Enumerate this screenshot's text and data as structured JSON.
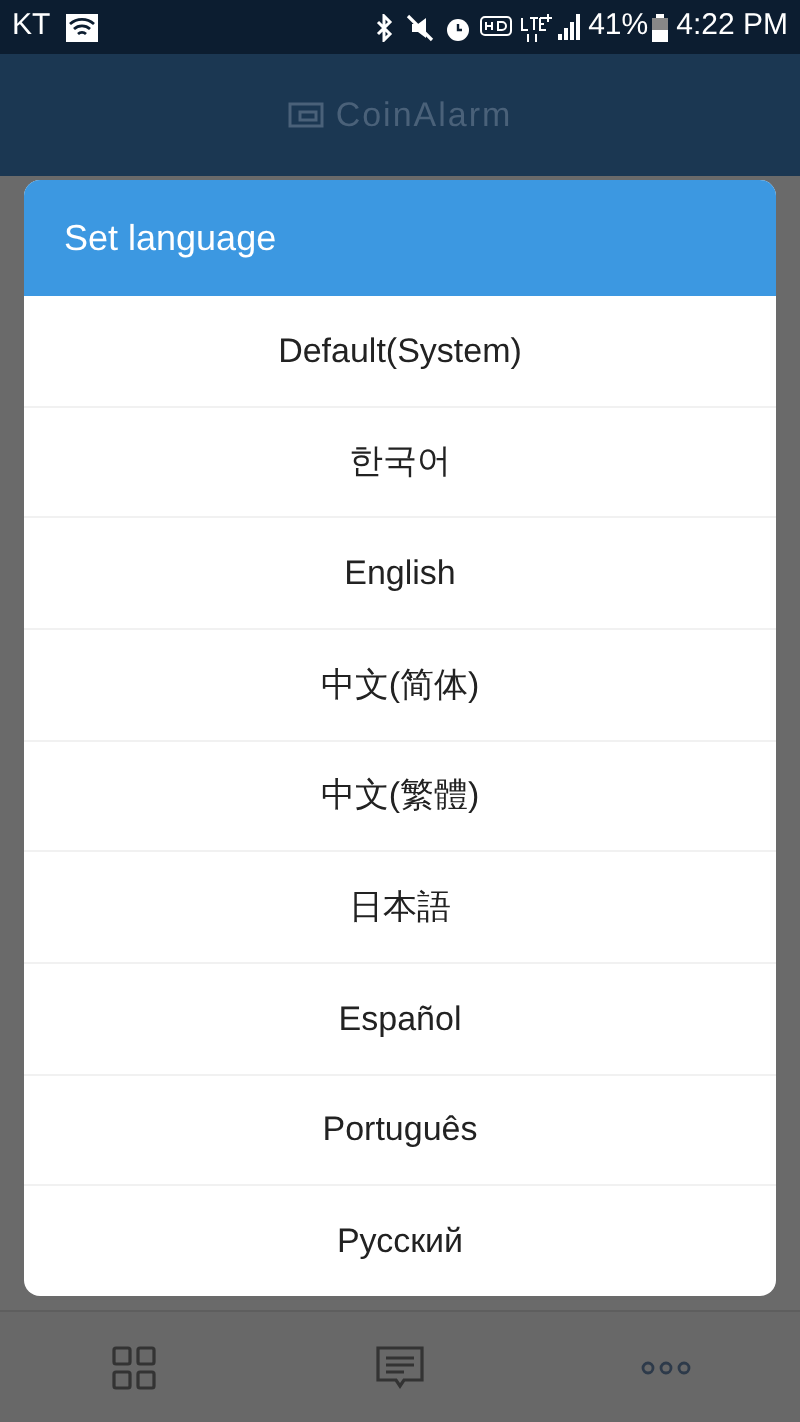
{
  "status_bar": {
    "carrier": "KT",
    "battery": "41%",
    "time": "4:22 PM"
  },
  "app_header": {
    "title": "CoinAlarm"
  },
  "dialog": {
    "title": "Set language",
    "options": [
      {
        "label": "Default(System)"
      },
      {
        "label": "한국어"
      },
      {
        "label": "English"
      },
      {
        "label": "中文(简体)"
      },
      {
        "label": "中文(繁體)"
      },
      {
        "label": "日本語"
      },
      {
        "label": "Español"
      },
      {
        "label": "Português"
      },
      {
        "label": "Русский"
      }
    ]
  },
  "bottom_nav": {
    "items": [
      {
        "kind": "grid"
      },
      {
        "kind": "chat"
      },
      {
        "kind": "more"
      }
    ]
  }
}
